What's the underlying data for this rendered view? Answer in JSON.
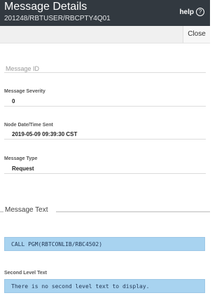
{
  "header": {
    "title": "Message Details",
    "subtitle": "201248/RBTUSER/RBCPTY4Q01",
    "help_label": "help",
    "help_icon": "question-circle-icon"
  },
  "toolbar": {
    "close_label": "Close"
  },
  "fields": {
    "message_id_label": "Message ID",
    "severity_label": "Message Severity",
    "severity_value": "0",
    "sent_label": "Node Date/Time Sent",
    "sent_value": "2019-05-09 09:39:30  CST",
    "type_label": "Message Type",
    "type_value": "Request"
  },
  "message_text": {
    "section_title": "Message Text",
    "value": "CALL PGM(RBTCONLIB/RBC4502)"
  },
  "second_level": {
    "label": "Second Level Text",
    "value": "There is no second level text to display."
  },
  "colors": {
    "header_bg": "#323940",
    "text_box_bg": "#a8d3f0"
  }
}
